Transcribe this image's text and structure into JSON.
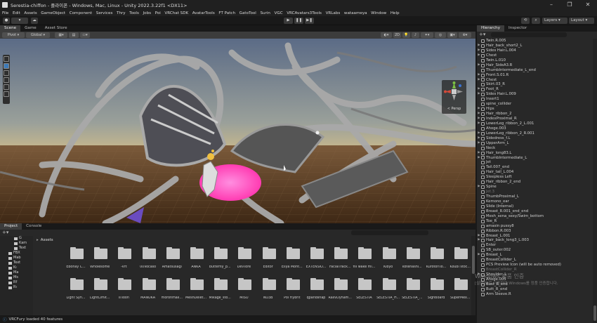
{
  "window": {
    "title": "Serestia-chiffon - 플라이폰 - Windows, Mac, Linux - Unity 2022.3.22f1 <DX11>",
    "controls": [
      "–",
      "❐",
      "✕"
    ]
  },
  "menu": [
    "File",
    "Edit",
    "Assets",
    "GameObject",
    "Component",
    "Services",
    "Thry",
    "Tools",
    "Jobs",
    "Poi",
    "VRChat SDK",
    "AvatarTools",
    "FT Patch",
    "GatoTool",
    "Surin",
    "VGC",
    "VRCAvatars3Tools",
    "VRLabs",
    "wataameya",
    "Window",
    "Help"
  ],
  "toolbar": {
    "layers": "Layers",
    "layout": "Layout"
  },
  "scene": {
    "tabs": [
      "Scene",
      "Game",
      "Asset Store"
    ],
    "pivot": "Pivot",
    "global": "Global",
    "mode_2d": "2D",
    "persp": "< Persp"
  },
  "hierarchy": {
    "tabs": [
      "Hierarchy",
      "Inspector"
    ],
    "items": [
      {
        "label": "Twin.R.005",
        "dim": false,
        "arrow": false
      },
      {
        "label": "Hair_back_short2_L",
        "dim": false,
        "arrow": true
      },
      {
        "label": "Sides Hair.L.004",
        "dim": false,
        "arrow": true
      },
      {
        "label": "Chest",
        "dim": false,
        "arrow": true
      },
      {
        "label": "Twin.L.010",
        "dim": false,
        "arrow": false
      },
      {
        "label": "Hair_SideA3.R",
        "dim": false,
        "arrow": true
      },
      {
        "label": "ThumbIntermediate_L_end",
        "dim": false,
        "arrow": false
      },
      {
        "label": "Front.S.01.R",
        "dim": false,
        "arrow": true
      },
      {
        "label": "Chest",
        "dim": false,
        "arrow": true
      },
      {
        "label": "Skirt.03_R",
        "dim": false,
        "arrow": false
      },
      {
        "label": "Foot_R",
        "dim": false,
        "arrow": true
      },
      {
        "label": "Sides Hair.L.009",
        "dim": false,
        "arrow": true
      },
      {
        "label": "Insert1",
        "dim": false,
        "arrow": false
      },
      {
        "label": "spine_collider",
        "dim": false,
        "arrow": false
      },
      {
        "label": "Hips",
        "dim": false,
        "arrow": true
      },
      {
        "label": "Hair_ribbon_2",
        "dim": false,
        "arrow": true
      },
      {
        "label": "IndexProximal_R",
        "dim": false,
        "arrow": true
      },
      {
        "label": "LowerLeg_ribbon_2_L.001",
        "dim": false,
        "arrow": true
      },
      {
        "label": "Ahoge.003",
        "dim": false,
        "arrow": false
      },
      {
        "label": "LowerLeg_ribbon_2_R.001",
        "dim": false,
        "arrow": true
      },
      {
        "label": "Sidedress_f.L",
        "dim": false,
        "arrow": true
      },
      {
        "label": "UpperArm_L",
        "dim": false,
        "arrow": true
      },
      {
        "label": "Neck",
        "dim": false,
        "arrow": false
      },
      {
        "label": "Hair_long83.L",
        "dim": false,
        "arrow": true
      },
      {
        "label": "ThumbIntermediate_L",
        "dim": false,
        "arrow": true
      },
      {
        "label": "Jet",
        "dim": false,
        "arrow": false
      },
      {
        "label": "Tail.007_end",
        "dim": false,
        "arrow": false
      },
      {
        "label": "Hair_tail_L.004",
        "dim": false,
        "arrow": false
      },
      {
        "label": "Sleepless Left",
        "dim": false,
        "arrow": false
      },
      {
        "label": "Hair_ribbon_2_end",
        "dim": false,
        "arrow": false
      },
      {
        "label": "Spine",
        "dim": false,
        "arrow": true
      },
      {
        "label": "Jet.3",
        "dim": true,
        "arrow": false
      },
      {
        "label": "ThumbProximal_L",
        "dim": false,
        "arrow": false
      },
      {
        "label": "Kemono_ear",
        "dim": false,
        "arrow": false
      },
      {
        "label": "Slide (Internal)",
        "dim": false,
        "arrow": false
      },
      {
        "label": "Breast_R.001_end_end",
        "dim": false,
        "arrow": false
      },
      {
        "label": "Mesh_sena_sexy/Swim_bottom",
        "dim": false,
        "arrow": false
      },
      {
        "label": "Toe_R",
        "dim": false,
        "arrow": false
      },
      {
        "label": "amasin pussy8",
        "dim": false,
        "arrow": false
      },
      {
        "label": "Ribbon.R.003",
        "dim": false,
        "arrow": false
      },
      {
        "label": "Breast_L.001",
        "dim": false,
        "arrow": true
      },
      {
        "label": "Hair_back_long3_L.003",
        "dim": false,
        "arrow": true
      },
      {
        "label": "Enter",
        "dim": false,
        "arrow": false
      },
      {
        "label": "SB_outer.002",
        "dim": false,
        "arrow": false
      },
      {
        "label": "Breast_L",
        "dim": false,
        "arrow": true
      },
      {
        "label": "BreastCollider_L",
        "dim": false,
        "arrow": false
      },
      {
        "label": "PCS Preview Icon (will be auto removed)",
        "dim": false,
        "arrow": false
      },
      {
        "label": "BreastCollider_R",
        "dim": true,
        "arrow": false
      },
      {
        "label": "Shoulder_L",
        "dim": false,
        "arrow": true
      },
      {
        "label": "Ahoge.005",
        "dim": false,
        "arrow": false
      },
      {
        "label": "Bust_R_end",
        "dim": false,
        "arrow": false
      },
      {
        "label": "Butt_R_end",
        "dim": false,
        "arrow": false
      },
      {
        "label": "Arm Sleeve.R",
        "dim": false,
        "arrow": false
      }
    ]
  },
  "project": {
    "tabs": [
      "Project",
      "Console"
    ],
    "breadcrumb": "Assets",
    "tree": [
      "G",
      "Kam",
      "Text",
      "FBX",
      "Mab",
      "Text",
      "Kı",
      "Ma",
      "Ms",
      "Rf",
      "Rı"
    ],
    "assets_row1": [
      "Ebonay C...",
      "Wholesome",
      "-Vrt",
      "00Vocaso",
      "Amatsusagi",
      "ANKA",
      "butterfly_p...",
      "DevTore",
      "Editor",
      "Eliya Morit...",
      "EXTENSIO...",
      "FacialTrack...",
      "fill wake mi...",
      "Kibyo",
      "kotenashi...",
      "KurotoriTo...",
      "Koubi stoc...",
      "Li-se"
    ],
    "assets_row2": [
      "Light Syn...",
      "LightLimit...",
      "lilToon",
      "MANUKA",
      "morohmali...",
      "MeshDelet...",
      "Mikage_sto...",
      "MISO",
      "NO3B",
      "Poi Fiybrit",
      "qpandsnap",
      "RalivDynam...",
      "SELESTIA",
      "SELESTIA_H...",
      "SELESTIA_...",
      "SignBoard",
      "SuperMex...",
      "Surin"
    ],
    "status": "VRCFury loaded 40 features"
  },
  "watermark": {
    "line1": "Windows 정품 인증",
    "line2": "[설정]으로 이동하여 Windows를 정품 인증합니다."
  },
  "colors": {
    "sky_top": "#5b6b86",
    "sky_horizon": "#c9b98c",
    "ground": "#5a3c22",
    "mesh": "#b3b3b3",
    "pink": "#ff3cb8"
  }
}
